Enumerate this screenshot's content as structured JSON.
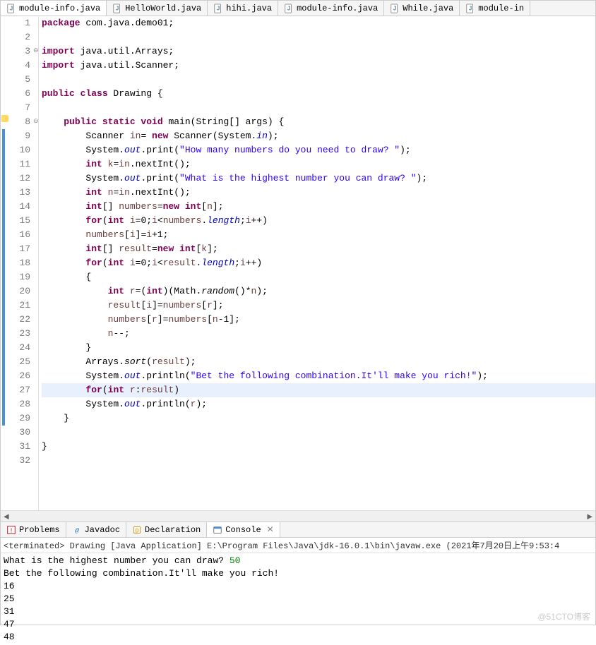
{
  "tabs": [
    {
      "label": "module-info.java",
      "active": true
    },
    {
      "label": "HelloWorld.java",
      "active": false
    },
    {
      "label": "hihi.java",
      "active": false
    },
    {
      "label": "module-info.java",
      "active": false
    },
    {
      "label": "While.java",
      "active": false
    },
    {
      "label": "module-in",
      "active": false
    }
  ],
  "code": {
    "lines": [
      {
        "n": "1",
        "tokens": [
          [
            "kw",
            "package"
          ],
          [
            "typ",
            " com.java.demo01;"
          ]
        ]
      },
      {
        "n": "2",
        "tokens": []
      },
      {
        "n": "3",
        "fold": "⊖",
        "tokens": [
          [
            "kw",
            "import"
          ],
          [
            "typ",
            " java.util.Arrays;"
          ]
        ]
      },
      {
        "n": "4",
        "tokens": [
          [
            "kw",
            "import"
          ],
          [
            "typ",
            " java.util.Scanner;"
          ]
        ]
      },
      {
        "n": "5",
        "tokens": []
      },
      {
        "n": "6",
        "tokens": [
          [
            "kw",
            "public class"
          ],
          [
            "typ",
            " Drawing {"
          ]
        ]
      },
      {
        "n": "7",
        "tokens": []
      },
      {
        "n": "8",
        "fold": "⊖",
        "marker": "warn",
        "tokens": [
          [
            "typ",
            "    "
          ],
          [
            "kw",
            "public static void"
          ],
          [
            "typ",
            " main(String[] args) {"
          ]
        ]
      },
      {
        "n": "9",
        "marker": "mod",
        "tokens": [
          [
            "typ",
            "        Scanner "
          ],
          [
            "u",
            "in"
          ],
          [
            "typ",
            "= "
          ],
          [
            "kw",
            "new"
          ],
          [
            "typ",
            " Scanner(System."
          ],
          [
            "fld",
            "in"
          ],
          [
            "typ",
            ");"
          ]
        ]
      },
      {
        "n": "10",
        "marker": "mod",
        "tokens": [
          [
            "typ",
            "        System."
          ],
          [
            "fld",
            "out"
          ],
          [
            "typ",
            ".print("
          ],
          [
            "str",
            "\"How many numbers do you need to draw? \""
          ],
          [
            "typ",
            ");"
          ]
        ]
      },
      {
        "n": "11",
        "marker": "mod",
        "tokens": [
          [
            "typ",
            "        "
          ],
          [
            "kw",
            "int"
          ],
          [
            "typ",
            " "
          ],
          [
            "u",
            "k"
          ],
          [
            "typ",
            "="
          ],
          [
            "u",
            "in"
          ],
          [
            "typ",
            ".nextInt();"
          ]
        ]
      },
      {
        "n": "12",
        "marker": "mod",
        "tokens": [
          [
            "typ",
            "        System."
          ],
          [
            "fld",
            "out"
          ],
          [
            "typ",
            ".print("
          ],
          [
            "str",
            "\"What is the highest number you can draw? \""
          ],
          [
            "typ",
            ");"
          ]
        ]
      },
      {
        "n": "13",
        "marker": "mod",
        "tokens": [
          [
            "typ",
            "        "
          ],
          [
            "kw",
            "int"
          ],
          [
            "typ",
            " "
          ],
          [
            "u",
            "n"
          ],
          [
            "typ",
            "="
          ],
          [
            "u",
            "in"
          ],
          [
            "typ",
            ".nextInt();"
          ]
        ]
      },
      {
        "n": "14",
        "marker": "mod",
        "tokens": [
          [
            "typ",
            "        "
          ],
          [
            "kw",
            "int"
          ],
          [
            "typ",
            "[] "
          ],
          [
            "u",
            "numbers"
          ],
          [
            "typ",
            "="
          ],
          [
            "kw",
            "new int"
          ],
          [
            "typ",
            "["
          ],
          [
            "u",
            "n"
          ],
          [
            "typ",
            "];"
          ]
        ]
      },
      {
        "n": "15",
        "marker": "mod",
        "tokens": [
          [
            "typ",
            "        "
          ],
          [
            "kw",
            "for"
          ],
          [
            "typ",
            "("
          ],
          [
            "kw",
            "int"
          ],
          [
            "typ",
            " "
          ],
          [
            "u",
            "i"
          ],
          [
            "typ",
            "=0;"
          ],
          [
            "u",
            "i"
          ],
          [
            "typ",
            "<"
          ],
          [
            "u",
            "numbers"
          ],
          [
            "typ",
            "."
          ],
          [
            "fld",
            "length"
          ],
          [
            "typ",
            ";"
          ],
          [
            "u",
            "i"
          ],
          [
            "typ",
            "++)"
          ]
        ]
      },
      {
        "n": "16",
        "marker": "mod",
        "tokens": [
          [
            "typ",
            "        "
          ],
          [
            "u",
            "numbers"
          ],
          [
            "typ",
            "["
          ],
          [
            "u",
            "i"
          ],
          [
            "typ",
            "]="
          ],
          [
            "u",
            "i"
          ],
          [
            "typ",
            "+1;"
          ]
        ]
      },
      {
        "n": "17",
        "marker": "mod",
        "tokens": [
          [
            "typ",
            "        "
          ],
          [
            "kw",
            "int"
          ],
          [
            "typ",
            "[] "
          ],
          [
            "u",
            "result"
          ],
          [
            "typ",
            "="
          ],
          [
            "kw",
            "new int"
          ],
          [
            "typ",
            "["
          ],
          [
            "u",
            "k"
          ],
          [
            "typ",
            "];"
          ]
        ]
      },
      {
        "n": "18",
        "marker": "mod",
        "tokens": [
          [
            "typ",
            "        "
          ],
          [
            "kw",
            "for"
          ],
          [
            "typ",
            "("
          ],
          [
            "kw",
            "int"
          ],
          [
            "typ",
            " "
          ],
          [
            "u",
            "i"
          ],
          [
            "typ",
            "=0;"
          ],
          [
            "u",
            "i"
          ],
          [
            "typ",
            "<"
          ],
          [
            "u",
            "result"
          ],
          [
            "typ",
            "."
          ],
          [
            "fld",
            "length"
          ],
          [
            "typ",
            ";"
          ],
          [
            "u",
            "i"
          ],
          [
            "typ",
            "++)"
          ]
        ]
      },
      {
        "n": "19",
        "marker": "mod",
        "tokens": [
          [
            "typ",
            "        {"
          ]
        ]
      },
      {
        "n": "20",
        "marker": "mod",
        "tokens": [
          [
            "typ",
            "            "
          ],
          [
            "kw",
            "int"
          ],
          [
            "typ",
            " "
          ],
          [
            "u",
            "r"
          ],
          [
            "typ",
            "=("
          ],
          [
            "kw",
            "int"
          ],
          [
            "typ",
            ")(Math."
          ],
          [
            "mth",
            "random"
          ],
          [
            "typ",
            "()*"
          ],
          [
            "u",
            "n"
          ],
          [
            "typ",
            ");"
          ]
        ]
      },
      {
        "n": "21",
        "marker": "mod",
        "tokens": [
          [
            "typ",
            "            "
          ],
          [
            "u",
            "result"
          ],
          [
            "typ",
            "["
          ],
          [
            "u",
            "i"
          ],
          [
            "typ",
            "]="
          ],
          [
            "u",
            "numbers"
          ],
          [
            "typ",
            "["
          ],
          [
            "u",
            "r"
          ],
          [
            "typ",
            "];"
          ]
        ]
      },
      {
        "n": "22",
        "marker": "mod",
        "tokens": [
          [
            "typ",
            "            "
          ],
          [
            "u",
            "numbers"
          ],
          [
            "typ",
            "["
          ],
          [
            "u",
            "r"
          ],
          [
            "typ",
            "]="
          ],
          [
            "u",
            "numbers"
          ],
          [
            "typ",
            "["
          ],
          [
            "u",
            "n"
          ],
          [
            "typ",
            "-1];"
          ]
        ]
      },
      {
        "n": "23",
        "marker": "mod",
        "tokens": [
          [
            "typ",
            "            "
          ],
          [
            "u",
            "n"
          ],
          [
            "typ",
            "--;"
          ]
        ]
      },
      {
        "n": "24",
        "marker": "mod",
        "tokens": [
          [
            "typ",
            "        }"
          ]
        ]
      },
      {
        "n": "25",
        "marker": "mod",
        "tokens": [
          [
            "typ",
            "        Arrays."
          ],
          [
            "mth",
            "sort"
          ],
          [
            "typ",
            "("
          ],
          [
            "u",
            "result"
          ],
          [
            "typ",
            ");"
          ]
        ]
      },
      {
        "n": "26",
        "marker": "mod",
        "tokens": [
          [
            "typ",
            "        System."
          ],
          [
            "fld",
            "out"
          ],
          [
            "typ",
            ".println("
          ],
          [
            "str",
            "\"Bet the following combination.It'll make you rich!\""
          ],
          [
            "typ",
            ");"
          ]
        ]
      },
      {
        "n": "27",
        "marker": "mod",
        "hl": true,
        "tokens": [
          [
            "typ",
            "        "
          ],
          [
            "kw",
            "for"
          ],
          [
            "typ",
            "("
          ],
          [
            "kw",
            "int"
          ],
          [
            "typ",
            " "
          ],
          [
            "u",
            "r"
          ],
          [
            "typ",
            ":"
          ],
          [
            "u",
            "result"
          ],
          [
            "typ",
            ")"
          ]
        ]
      },
      {
        "n": "28",
        "marker": "mod",
        "tokens": [
          [
            "typ",
            "        System."
          ],
          [
            "fld",
            "out"
          ],
          [
            "typ",
            ".println("
          ],
          [
            "u",
            "r"
          ],
          [
            "typ",
            ");"
          ]
        ]
      },
      {
        "n": "29",
        "marker": "mod",
        "tokens": [
          [
            "typ",
            "    }"
          ]
        ]
      },
      {
        "n": "30",
        "tokens": []
      },
      {
        "n": "31",
        "tokens": [
          [
            "typ",
            "}"
          ]
        ]
      },
      {
        "n": "32",
        "tokens": []
      }
    ]
  },
  "views": [
    {
      "label": "Problems",
      "icon": "problems-icon",
      "active": false
    },
    {
      "label": "Javadoc",
      "icon": "javadoc-icon",
      "active": false
    },
    {
      "label": "Declaration",
      "icon": "declaration-icon",
      "active": false
    },
    {
      "label": "Console",
      "icon": "console-icon",
      "active": true
    }
  ],
  "console": {
    "header": "<terminated> Drawing [Java Application] E:\\Program Files\\Java\\jdk-16.0.1\\bin\\javaw.exe  (2021年7月20日上午9:53:4",
    "lines": [
      {
        "text": "What is the highest number you can draw? ",
        "input": "50"
      },
      {
        "text": "Bet the following combination.It'll make you rich!"
      },
      {
        "text": "16"
      },
      {
        "text": "25"
      },
      {
        "text": "31"
      },
      {
        "text": "47"
      },
      {
        "text": "48"
      }
    ]
  },
  "watermark": "@51CTO博客"
}
